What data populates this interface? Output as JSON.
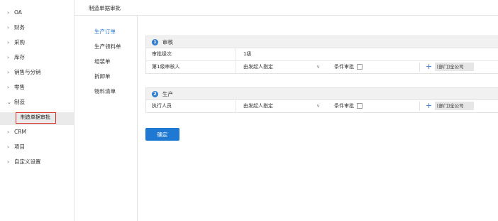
{
  "sidebar": {
    "items": [
      {
        "label": "OA",
        "chevron": "›"
      },
      {
        "label": "财务",
        "chevron": "›"
      },
      {
        "label": "采购",
        "chevron": "›"
      },
      {
        "label": "库存",
        "chevron": "›"
      },
      {
        "label": "销售与分销",
        "chevron": "›"
      },
      {
        "label": "零售",
        "chevron": "›"
      },
      {
        "label": "制造",
        "chevron": "⌄"
      },
      {
        "label": "CRM",
        "chevron": "›"
      },
      {
        "label": "项目",
        "chevron": "›"
      },
      {
        "label": "自定义设置",
        "chevron": "›"
      }
    ],
    "active_sub": "制造单据审批"
  },
  "breadcrumb": "制造单据审批",
  "submenu": {
    "items": [
      "生产订单",
      "生产领料单",
      "组装单",
      "拆卸单",
      "物料清单"
    ],
    "active_index": 0
  },
  "steps": [
    {
      "num": "1",
      "title": "审核",
      "level_label": "审批级次",
      "level_value": "1级",
      "rows": [
        {
          "label": "第1级审核人",
          "select": "由发起人指定",
          "cond": "条件审批",
          "tag": "[部门]全公司"
        }
      ]
    },
    {
      "num": "2",
      "title": "生产",
      "rows": [
        {
          "label": "执行人员",
          "select": "由发起人指定",
          "cond": "条件审批",
          "tag": "[部门]全公司"
        }
      ]
    }
  ],
  "confirm_label": "确定",
  "colors": {
    "accent": "#2d7dd2",
    "button": "#1f78d1",
    "highlight_border": "#d9302b"
  }
}
